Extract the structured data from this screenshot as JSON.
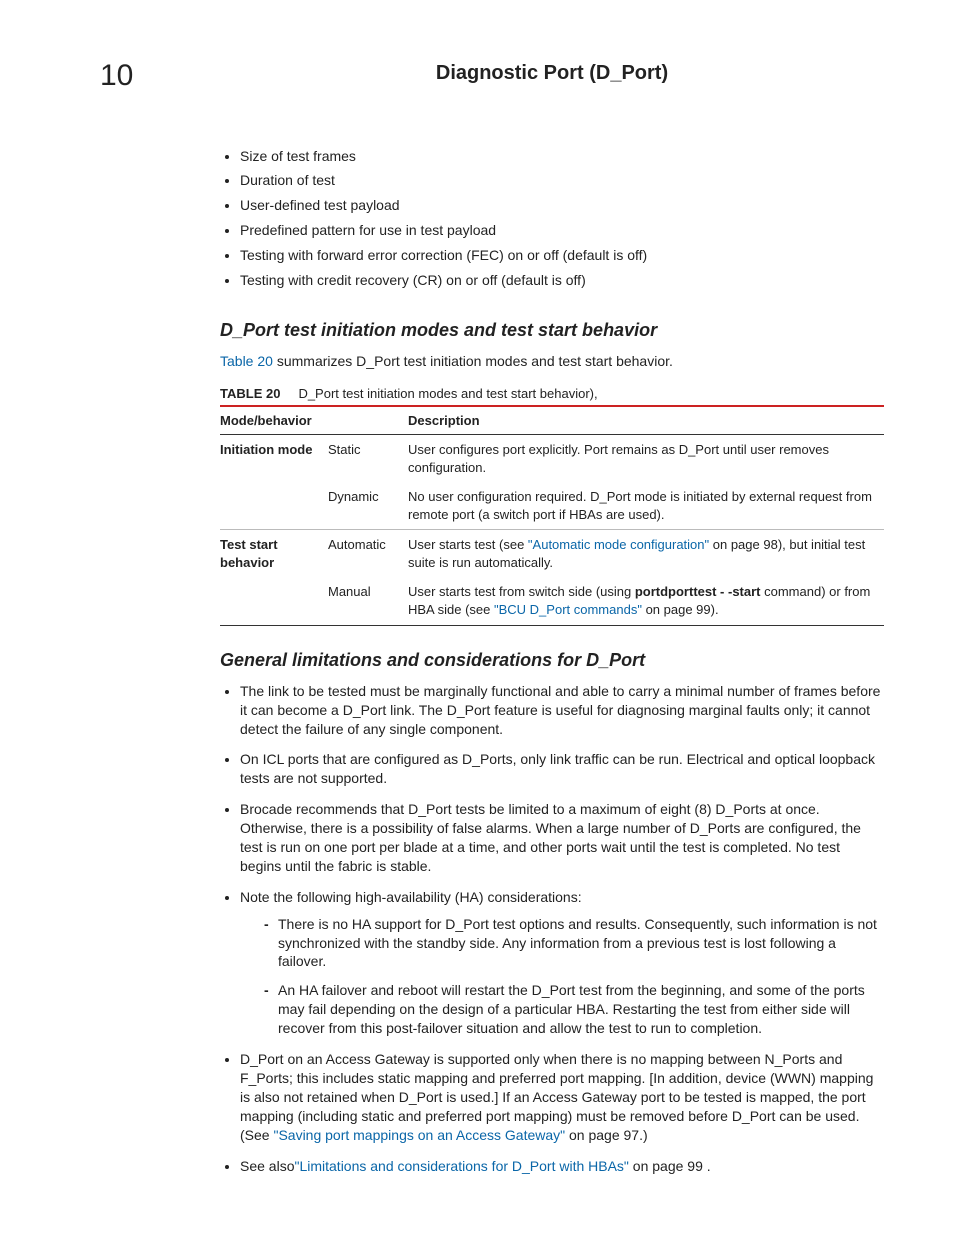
{
  "header": {
    "chapter_number": "10",
    "title": "Diagnostic Port (D_Port)"
  },
  "top_bullets": [
    "Size of test frames",
    "Duration of test",
    "User-defined test payload",
    "Predefined pattern for use in test payload",
    "Testing with forward error correction (FEC) on or off (default is off)",
    "Testing with credit recovery (CR) on or off (default is off)"
  ],
  "section1": {
    "heading": "D_Port test initiation modes and test start behavior",
    "intro_pre": "",
    "intro_link": "Table 20",
    "intro_post": " summarizes D_Port test initiation modes and test start behavior."
  },
  "table": {
    "label": "TABLE 20",
    "caption": "D_Port test initiation modes and test start behavior),",
    "headers": {
      "c1": "Mode/behavior",
      "c2": "",
      "c3": "Description"
    },
    "rows": [
      {
        "rowhdr": "Initiation mode",
        "mode": "Static",
        "desc_pre": "User configures port explicitly. Port remains as D_Port until user removes configuration.",
        "link": "",
        "desc_post": ""
      },
      {
        "rowhdr": "",
        "mode": "Dynamic",
        "desc_pre": "No user configuration required. D_Port mode is initiated by external request from remote port (a switch port if HBAs are used).",
        "link": "",
        "desc_post": ""
      },
      {
        "rowhdr": "Test start behavior",
        "mode": "Automatic",
        "desc_pre": "User starts test (see ",
        "link": "\"Automatic mode configuration\"",
        "desc_post": " on page 98), but initial test suite is run automatically.",
        "sep": true
      },
      {
        "rowhdr": "",
        "mode": "Manual",
        "desc_pre": "User starts test from switch side (using ",
        "cmd": "portdporttest - -start",
        "desc_mid": " command) or from HBA side (see ",
        "link": "\"BCU D_Port commands\"",
        "desc_post": " on page 99)."
      }
    ]
  },
  "section2": {
    "heading": "General limitations and considerations for D_Port",
    "items": [
      {
        "text": "The link to be tested must be marginally functional and able to carry a minimal number of frames before it can become a D_Port link. The D_Port feature is useful for diagnosing marginal faults only; it cannot detect the failure of any single component."
      },
      {
        "text": "On ICL ports that are configured as D_Ports, only link traffic can be run. Electrical and optical loopback tests are not supported."
      },
      {
        "text": "Brocade recommends that D_Port tests be limited to a maximum of eight (8) D_Ports at once. Otherwise, there is a possibility of false alarms. When a large number of D_Ports are configured, the test is run on one port per blade at a time, and other ports wait until the test is completed. No test begins until the fabric is stable."
      },
      {
        "text": "Note the following high-availability (HA) considerations:",
        "sub": [
          "There is no HA support for D_Port test options and results. Consequently, such information is not synchronized with the standby side. Any information from a previous test is lost following a failover.",
          "An HA failover and reboot will restart the D_Port test from the beginning, and some of the ports may fail depending on the design of a particular HBA. Restarting the test from either side will recover from this post-failover situation and allow the test to run to completion."
        ]
      },
      {
        "pre": "D_Port on an Access Gateway is supported only when there is no mapping between N_Ports and F_Ports; this includes static mapping and preferred port mapping. [In addition, device (WWN) mapping is also not retained when D_Port is used.] If an Access Gateway port to be tested is mapped, the port mapping (including static and preferred port mapping) must be removed before D_Port can be used. (See ",
        "link": "\"Saving port mappings on an Access Gateway\"",
        "post": " on page 97.)"
      },
      {
        "pre": "See also",
        "link": "\"Limitations and considerations for D_Port with HBAs\"",
        "post": " on page 99 ."
      }
    ]
  }
}
